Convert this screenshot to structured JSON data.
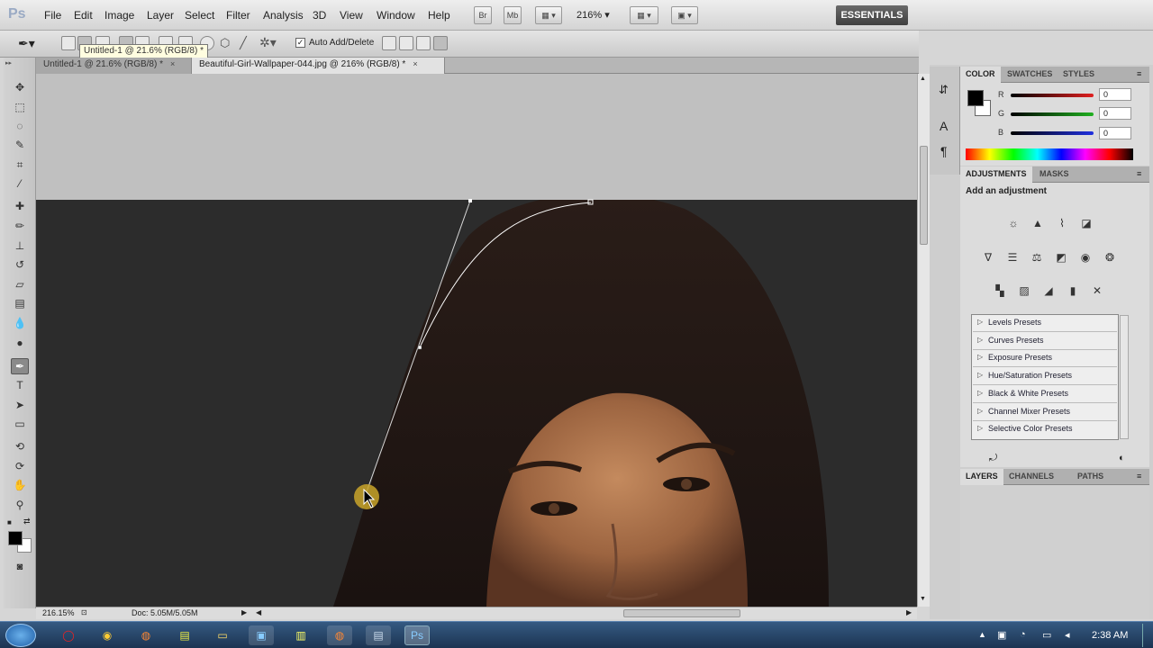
{
  "app": {
    "logo": "Ps"
  },
  "menu": [
    "File",
    "Edit",
    "Image",
    "Layer",
    "Select",
    "Filter",
    "Analysis",
    "3D",
    "View",
    "Window",
    "Help"
  ],
  "menubar_buttons": {
    "br": "Br",
    "mb": "Mb",
    "zoom": "216%",
    "workspace": "ESSENTIALS"
  },
  "options": {
    "auto_add_delete": "Auto Add/Delete",
    "tooltip": "Untitled-1 @ 21.6% (RGB/8) *"
  },
  "tabs": [
    {
      "label": "Untitled-1 @ 21.6% (RGB/8) *",
      "close": "×"
    },
    {
      "label": "Beautiful-Girl-Wallpaper-044.jpg @ 216% (RGB/8) *",
      "close": "×"
    }
  ],
  "status": {
    "zoom": "216.15%",
    "doc": "Doc: 5.05M/5.05M"
  },
  "color_panel": {
    "tabs": [
      "COLOR",
      "SWATCHES",
      "STYLES"
    ],
    "channels": [
      {
        "label": "R",
        "value": "0",
        "color": "#e02020"
      },
      {
        "label": "G",
        "value": "0",
        "color": "#20b020"
      },
      {
        "label": "B",
        "value": "0",
        "color": "#2030e0"
      }
    ]
  },
  "adjustments_panel": {
    "tabs": [
      "ADJUSTMENTS",
      "MASKS"
    ],
    "heading": "Add an adjustment",
    "presets": [
      "Levels Presets",
      "Curves Presets",
      "Exposure Presets",
      "Hue/Saturation Presets",
      "Black & White Presets",
      "Channel Mixer Presets",
      "Selective Color Presets"
    ]
  },
  "layers_panel": {
    "tabs": [
      "LAYERS",
      "CHANNELS",
      "PATHS"
    ]
  },
  "taskbar": {
    "time": "2:38 AM"
  }
}
